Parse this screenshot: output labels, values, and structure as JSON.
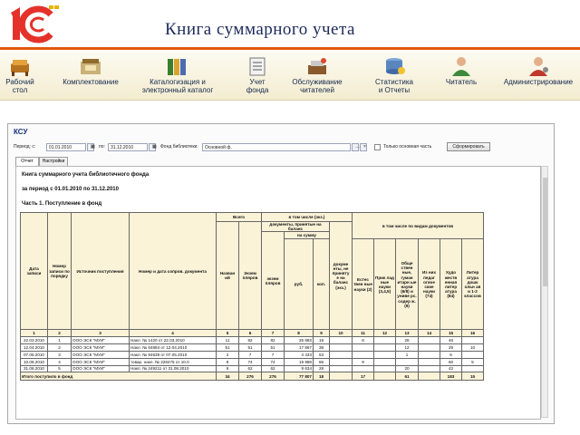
{
  "header": {
    "logo_text": "1С",
    "title": "Книга суммарного учета"
  },
  "toolbar": {
    "items": [
      {
        "label1": "Рабочий",
        "label2": "стол",
        "icon": "desktop-icon"
      },
      {
        "label1": "Комплектование",
        "label2": "",
        "icon": "acquisition-icon"
      },
      {
        "label1": "Каталогизация и",
        "label2": "электронный каталог",
        "icon": "catalog-icon"
      },
      {
        "label1": "Учет",
        "label2": "фонда",
        "icon": "fund-accounting-icon"
      },
      {
        "label1": "Обслуживание",
        "label2": "читателей",
        "icon": "reader-service-icon"
      },
      {
        "label1": "Статистика",
        "label2": "и Отчеты",
        "icon": "statistics-icon"
      },
      {
        "label1": "Читатель",
        "label2": "",
        "icon": "reader-icon"
      },
      {
        "label1": "Администрирование",
        "label2": "",
        "icon": "admin-icon"
      }
    ]
  },
  "form": {
    "title": "КСУ",
    "period_label": "Период: с:",
    "date_from": "01.01.2010",
    "to_label": "по:",
    "date_to": "31.12.2010",
    "fund_label": "Фонд библиотеки:",
    "fund_value": "Основной ф.",
    "only_main_label": "Только основная часть",
    "generate_button": "Сформировать",
    "tabs": [
      "Отчет",
      "Настройки"
    ]
  },
  "report": {
    "title": "Книга суммарного учета библиотечного фонда",
    "period": "за период с 01.01.2010 по 31.12.2010",
    "part": "Часть 1. Поступление в фонд",
    "headers": {
      "date": "Дата записи",
      "number": "Номер записи по порядку",
      "source": "Источник поступления",
      "doc": "Номер и дата сопров. документа",
      "total": "Всего",
      "titles": "Назван ий",
      "copies": "Экзем пляров",
      "incl": "в том числе (экз.)",
      "docs_accepted": "документы, принятые на баланс",
      "acc_copies": "экзем пляров",
      "acc_sum": "на сумму",
      "rub": "руб.",
      "kop": "коп.",
      "docs_not_accepted": "докуме нты, не приняту е на баланс (экз.)",
      "by_types": "в том числе по видам документов",
      "natural": "Естес твен ные науки (2)",
      "applied": "Прик лад ные науки (3,4,5)",
      "social": "Обще ствен ные, гуман итарн ые науки (6/8) и униве рс. содер ж. (9)",
      "pedagogy": "Из них педаг огиче ские науки (74)",
      "fiction": "Худо жеств енная литер атура (84)",
      "school": "Литер атура дошк ольн ая и 1-2 классов"
    },
    "column_numbers": [
      "1",
      "2",
      "3",
      "4",
      "5",
      "6",
      "7",
      "8",
      "9",
      "10",
      "11",
      "12",
      "13",
      "14",
      "15",
      "16"
    ],
    "rows": [
      [
        "22.03.2010",
        "1",
        "ООО ЭСК \"МУИ\"",
        "Накл. № 1420 от 22.03.2010",
        "11",
        "82",
        "82",
        "25 883",
        "19",
        "",
        "6",
        "",
        "28",
        "",
        "46",
        ""
      ],
      [
        "12.04.2010",
        "2",
        "ООО ЭСК \"МУИ\"",
        "Накл. № 64884 от 12.04.2010",
        "51",
        "51",
        "51",
        "17 867",
        "38",
        "",
        "",
        "",
        "12",
        "",
        "29",
        "10"
      ],
      [
        "07.05.2010",
        "3",
        "ООО ЭСК \"МУИ\"",
        "Накл. № 94639 от 07.05.2010",
        "2",
        "7",
        "7",
        "4 433",
        "53",
        "",
        "",
        "",
        "1",
        "",
        "6",
        ""
      ],
      [
        "10.08.2010",
        "4",
        "ООО ЭСК \"МУИ\"",
        "товар. накл. № 228475 от 10.0",
        "8",
        "74",
        "74",
        "19 988",
        "86",
        "",
        "9",
        "",
        "",
        "",
        "60",
        "5"
      ],
      [
        "31.08.2010",
        "5",
        "ООО ЭСК \"МУИ\"",
        "Накл. № 249211 от 31.08.2010",
        "6",
        "62",
        "62",
        "9 634",
        "28",
        "",
        "",
        "",
        "20",
        "",
        "42",
        ""
      ]
    ],
    "total": [
      "Итого поступило в фонд",
      "34",
      "276",
      "276",
      "77 807",
      "18",
      "",
      "17",
      "",
      "61",
      "",
      "183",
      "15"
    ]
  }
}
